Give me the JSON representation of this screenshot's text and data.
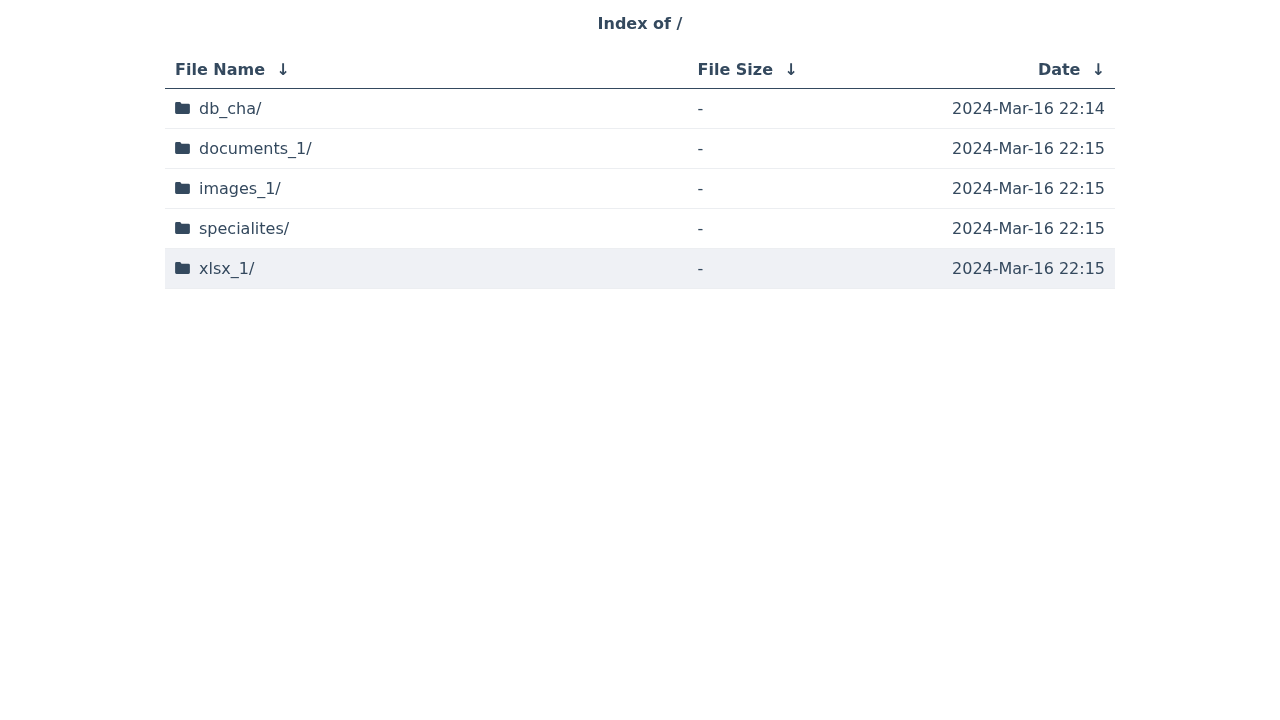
{
  "title": "Index of /",
  "table": {
    "columns": [
      {
        "label": "File Name",
        "sort_arrow": "↓"
      },
      {
        "label": "File Size",
        "sort_arrow": "↓"
      },
      {
        "label": "Date",
        "sort_arrow": "↓"
      }
    ],
    "rows": [
      {
        "name": "db_cha/",
        "size": "-",
        "date": "2024-Mar-16 22:14",
        "selected": false
      },
      {
        "name": "documents_1/",
        "size": "-",
        "date": "2024-Mar-16 22:15",
        "selected": false
      },
      {
        "name": "images_1/",
        "size": "-",
        "date": "2024-Mar-16 22:15",
        "selected": false
      },
      {
        "name": "specialites/",
        "size": "-",
        "date": "2024-Mar-16 22:15",
        "selected": false
      },
      {
        "name": "xlsx_1/",
        "size": "-",
        "date": "2024-Mar-16 22:15",
        "selected": true
      }
    ]
  }
}
